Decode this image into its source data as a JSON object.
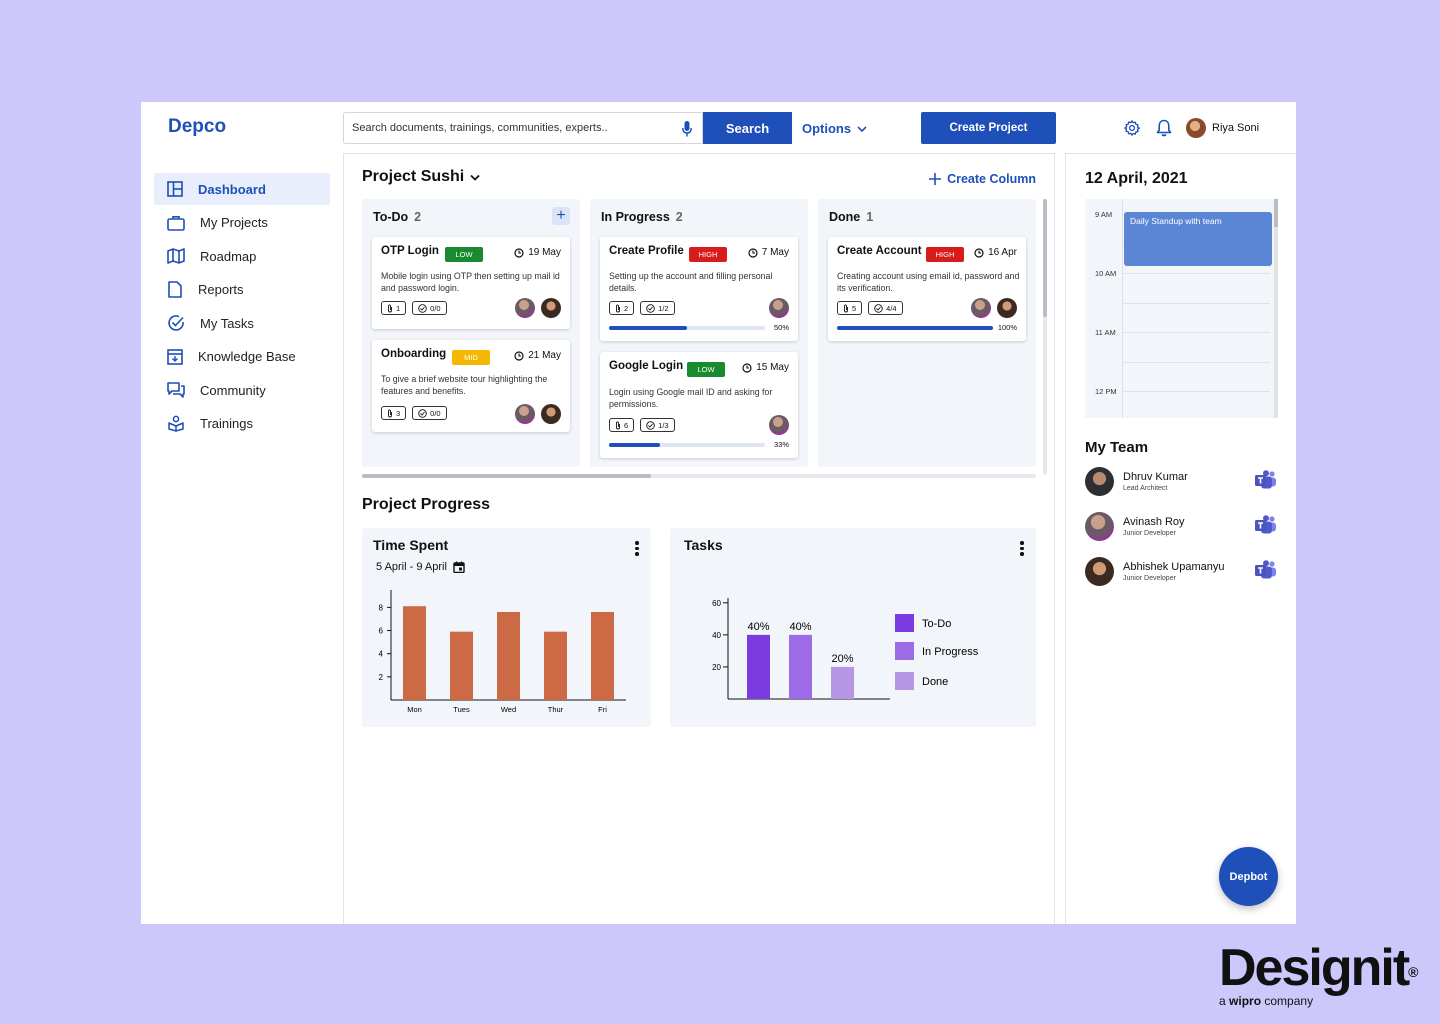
{
  "header": {
    "logo": "Depco",
    "search_placeholder": "Search documents, trainings, communities, experts..",
    "search_label": "Search",
    "options_label": "Options",
    "create_project_label": "Create Project",
    "user_name": "Riya Soni"
  },
  "sidebar": {
    "items": [
      {
        "label": "Dashboard",
        "icon": "dashboard-icon",
        "active": true
      },
      {
        "label": "My Projects",
        "icon": "briefcase-icon"
      },
      {
        "label": "Roadmap",
        "icon": "map-icon"
      },
      {
        "label": "Reports",
        "icon": "report-icon"
      },
      {
        "label": "My Tasks",
        "icon": "check-circle-icon"
      },
      {
        "label": "Knowledge Base",
        "icon": "archive-icon"
      },
      {
        "label": "Community",
        "icon": "chat-icon"
      },
      {
        "label": "Trainings",
        "icon": "training-icon"
      }
    ]
  },
  "board": {
    "project_name": "Project Sushi",
    "create_column_label": "Create Column",
    "columns": [
      {
        "title": "To-Do",
        "count": "2",
        "cards": [
          {
            "title": "OTP Login",
            "tag": "LOW",
            "tag_color": "#1a8a2e",
            "date": "19 May",
            "desc": "Mobile login using OTP then setting up mail id and password login.",
            "attachments": "1",
            "checks": "0/0"
          },
          {
            "title": "Onboarding",
            "tag": "MID",
            "tag_color": "#f5b800",
            "date": "21 May",
            "desc": "To give a brief website tour highlighting the features and benefits.",
            "attachments": "3",
            "checks": "0/0"
          }
        ]
      },
      {
        "title": "In Progress",
        "count": "2",
        "cards": [
          {
            "title": "Create Profile",
            "tag": "HIGH",
            "tag_color": "#d81b1b",
            "date": "7 May",
            "desc": "Setting up the account and filling personal details.",
            "attachments": "2",
            "checks": "1/2",
            "progress": 0.5,
            "progress_label": "50%"
          },
          {
            "title": "Google Login",
            "tag": "LOW",
            "tag_color": "#1a8a2e",
            "date": "15 May",
            "desc": "Login using Google mail ID and asking for permissions.",
            "attachments": "6",
            "checks": "1/3",
            "progress": 0.33,
            "progress_label": "33%"
          }
        ]
      },
      {
        "title": "Done",
        "count": "1",
        "cards": [
          {
            "title": "Create Account",
            "tag": "HIGH",
            "tag_color": "#d81b1b",
            "date": "16 Apr",
            "desc": "Creating account using email id, password and its verification.",
            "attachments": "5",
            "checks": "4/4",
            "progress": 1.0,
            "progress_label": "100%"
          }
        ]
      }
    ]
  },
  "progress_section": {
    "title": "Project Progress",
    "time_spent": {
      "title": "Time Spent",
      "range": "5 April - 9 April"
    },
    "tasks": {
      "title": "Tasks"
    }
  },
  "chart_data": [
    {
      "type": "bar",
      "title": "Time Spent",
      "categories": [
        "Mon",
        "Tues",
        "Wed",
        "Thur",
        "Fri"
      ],
      "values": [
        8.1,
        5.9,
        7.6,
        5.9,
        7.6
      ],
      "yticks": [
        "2",
        "4",
        "6",
        "8"
      ],
      "ylim": [
        0,
        9.5
      ],
      "color": "#cc6a45"
    },
    {
      "type": "bar",
      "title": "Tasks",
      "categories": [
        "To-Do",
        "In Progress",
        "Done"
      ],
      "values": [
        40,
        40,
        20
      ],
      "data_labels": [
        "40%",
        "40%",
        "20%"
      ],
      "yticks": [
        "20",
        "40",
        "60"
      ],
      "ylim": [
        0,
        63
      ],
      "colors": [
        "#7a3be0",
        "#9d6ae8",
        "#b896e6"
      ],
      "legend": [
        "To-Do",
        "In Progress",
        "Done"
      ],
      "legend_position": "right"
    }
  ],
  "calendar": {
    "date": "12 April, 2021",
    "hours": [
      "9 AM",
      "10 AM",
      "11 AM",
      "12 PM"
    ],
    "event": "Daily Standup with team"
  },
  "team": {
    "title": "My Team",
    "members": [
      {
        "name": "Dhruv Kumar",
        "role": "Lead Architect"
      },
      {
        "name": "Avinash Roy",
        "role": "Junior Developer"
      },
      {
        "name": "Abhishek Upamanyu",
        "role": "Junior Developer"
      }
    ]
  },
  "depbot_label": "Depbot",
  "brand": {
    "name": "Designit",
    "mark": "®",
    "sub_prefix": "a",
    "sub_bold": "wipro",
    "sub_suffix": "company"
  }
}
